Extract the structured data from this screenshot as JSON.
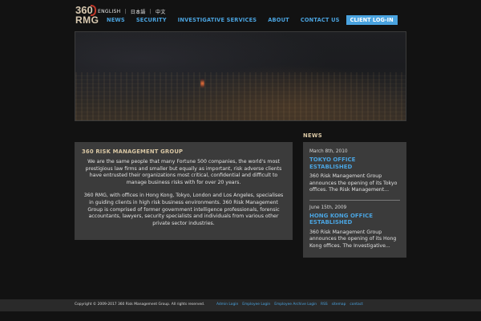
{
  "logo": {
    "line1": "360",
    "line2": "RMG"
  },
  "languages": [
    "ENGLISH",
    "日本語",
    "中文"
  ],
  "nav": {
    "items": [
      "NEWS",
      "SECURITY",
      "INVESTIGATIVE SERVICES",
      "ABOUT",
      "CONTACT US"
    ],
    "client_login": "CLIENT LOG-IN"
  },
  "about": {
    "heading": "360 RISK MANAGEMENT GROUP",
    "paragraph1": "We are the same people that many Fortune 500 companies, the world's most prestigious law firms and smaller but equally as important, risk adverse clients have entrusted their organizations most critical, confidential and difficult to manage business risks with for over 20 years.",
    "paragraph2": "360 RMG, with  offices in Hong Kong, Tokyo, London and Los Angeles, specialises in guiding clients in high risk business environments.  360 Risk Management Group is comprised of  former government intelligence professionals, forensic accountants, lawyers, security specialists and individuals from various other private sector industries."
  },
  "news": {
    "heading": "NEWS",
    "entries": [
      {
        "date": "March 8th, 2010",
        "title": "TOKYO OFFICE ESTABLISHED",
        "summary": "360 Risk Management Group announces the opening of its Tokyo offices.  The Risk Management..."
      },
      {
        "date": "June 15th, 2009",
        "title": "HONG KONG OFFICE ESTABLISHED",
        "summary": "360 Risk Management Group announces the opening of its Hong Kong offices. The Investigative..."
      }
    ]
  },
  "footer": {
    "copyright": "Copyright © 2009-2017 360 Risk Management Group. All rights reserved.",
    "links": [
      "Admin Login",
      "Employee Login",
      "Employee Archive Login",
      "RSS",
      "sitemap",
      "contact"
    ]
  },
  "colors": {
    "accent": "#4aa3df",
    "heading": "#d9c7a4",
    "panel": "#3b3b3b",
    "background": "#121212"
  }
}
